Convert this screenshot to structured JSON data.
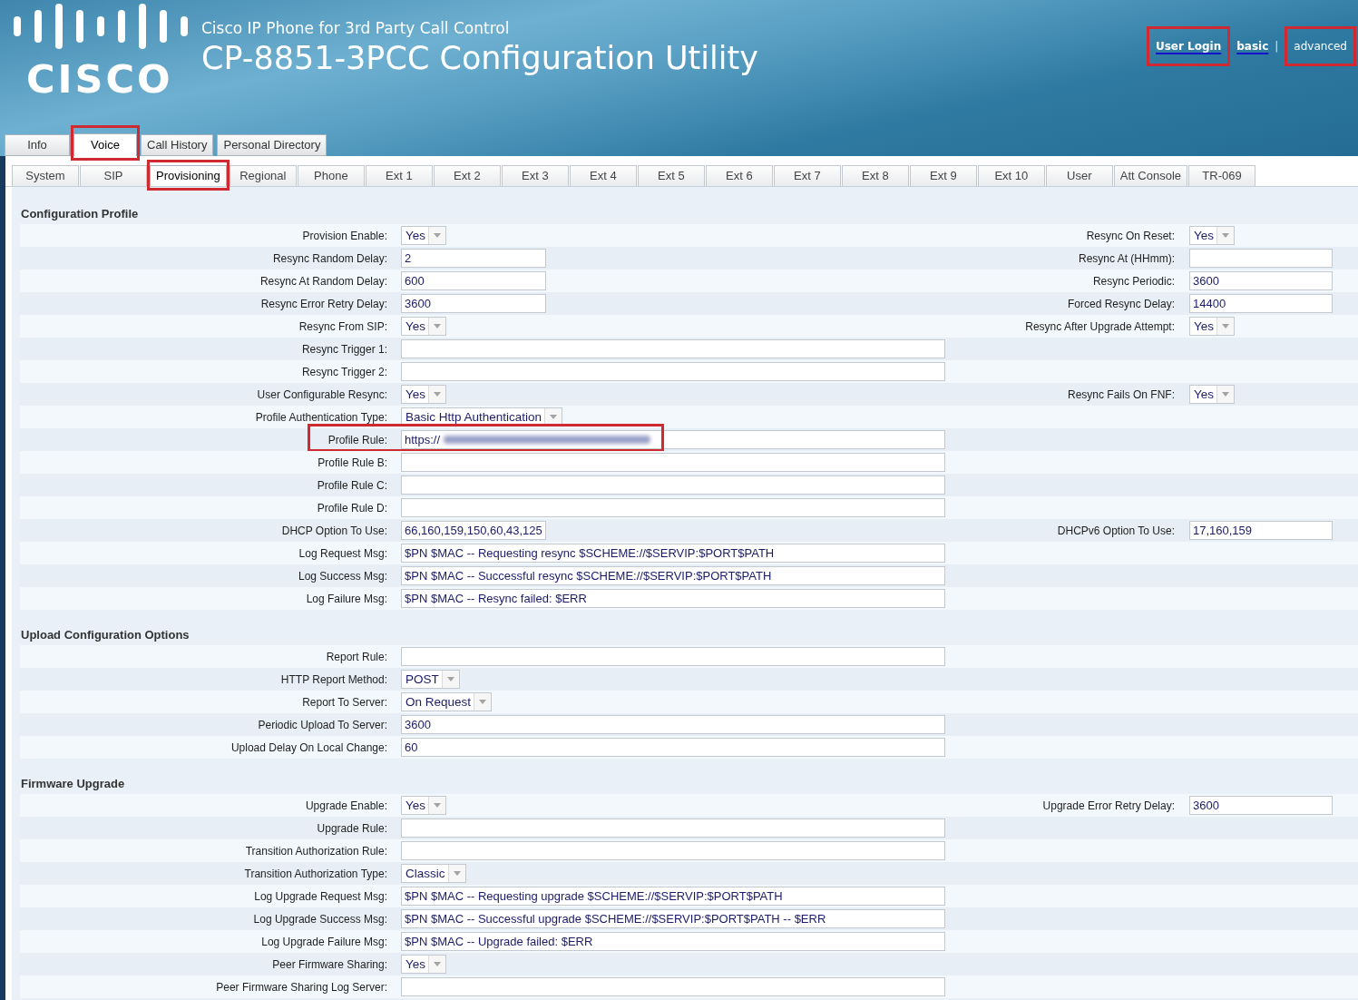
{
  "header": {
    "logo_text": "CISCO",
    "subtitle": "Cisco IP Phone for 3rd Party Call Control",
    "title": "CP-8851-3PCC Configuration Utility",
    "login_link": {
      "label": "User Login",
      "highlighted": true
    },
    "view_modes": [
      {
        "label": "basic",
        "selected": false,
        "highlighted": false
      },
      {
        "label": "advanced",
        "selected": true,
        "highlighted": true
      }
    ],
    "mode_separator": "|"
  },
  "main_tabs": [
    {
      "label": "Info",
      "selected": false,
      "highlighted": false
    },
    {
      "label": "Voice",
      "selected": true,
      "highlighted": true
    },
    {
      "label": "Call History",
      "selected": false,
      "highlighted": false
    },
    {
      "label": "Personal Directory",
      "selected": false,
      "highlighted": false
    }
  ],
  "sub_tabs": [
    {
      "label": "System",
      "selected": false,
      "highlighted": false
    },
    {
      "label": "SIP",
      "selected": false,
      "highlighted": false
    },
    {
      "label": "Provisioning",
      "selected": true,
      "highlighted": true
    },
    {
      "label": "Regional",
      "selected": false,
      "highlighted": false
    },
    {
      "label": "Phone",
      "selected": false,
      "highlighted": false
    },
    {
      "label": "Ext 1",
      "selected": false,
      "highlighted": false
    },
    {
      "label": "Ext 2",
      "selected": false,
      "highlighted": false
    },
    {
      "label": "Ext 3",
      "selected": false,
      "highlighted": false
    },
    {
      "label": "Ext 4",
      "selected": false,
      "highlighted": false
    },
    {
      "label": "Ext 5",
      "selected": false,
      "highlighted": false
    },
    {
      "label": "Ext 6",
      "selected": false,
      "highlighted": false
    },
    {
      "label": "Ext 7",
      "selected": false,
      "highlighted": false
    },
    {
      "label": "Ext 8",
      "selected": false,
      "highlighted": false
    },
    {
      "label": "Ext 9",
      "selected": false,
      "highlighted": false
    },
    {
      "label": "Ext 10",
      "selected": false,
      "highlighted": false
    },
    {
      "label": "User",
      "selected": false,
      "highlighted": false
    },
    {
      "label": "Att Console",
      "selected": false,
      "highlighted": false
    },
    {
      "label": "TR-069",
      "selected": false,
      "highlighted": false
    }
  ],
  "sections": [
    {
      "title": "Configuration Profile",
      "rows": [
        {
          "highlighted": false,
          "left": {
            "label": "Provision Enable:",
            "kind": "select",
            "value": "Yes"
          },
          "right": {
            "label": "Resync On Reset:",
            "kind": "select",
            "value": "Yes"
          }
        },
        {
          "highlighted": false,
          "left": {
            "label": "Resync Random Delay:",
            "kind": "short",
            "value": "2"
          },
          "right": {
            "label": "Resync At (HHmm):",
            "kind": "short"
          }
        },
        {
          "highlighted": false,
          "left": {
            "label": "Resync At Random Delay:",
            "kind": "short",
            "value": "600"
          },
          "right": {
            "label": "Resync Periodic:",
            "kind": "short",
            "value": "3600"
          }
        },
        {
          "highlighted": false,
          "left": {
            "label": "Resync Error Retry Delay:",
            "kind": "short",
            "value": "3600"
          },
          "right": {
            "label": "Forced Resync Delay:",
            "kind": "short",
            "value": "14400"
          }
        },
        {
          "highlighted": false,
          "left": {
            "label": "Resync From SIP:",
            "kind": "select",
            "value": "Yes"
          },
          "right": {
            "label": "Resync After Upgrade Attempt:",
            "kind": "select",
            "value": "Yes"
          }
        },
        {
          "highlighted": false,
          "left": {
            "label": "Resync Trigger 1:",
            "kind": "long"
          }
        },
        {
          "highlighted": false,
          "left": {
            "label": "Resync Trigger 2:",
            "kind": "long"
          }
        },
        {
          "highlighted": false,
          "left": {
            "label": "User Configurable Resync:",
            "kind": "select",
            "value": "Yes"
          },
          "right": {
            "label": "Resync Fails On FNF:",
            "kind": "select",
            "value": "Yes"
          }
        },
        {
          "highlighted": false,
          "left": {
            "label": "Profile Authentication Type:",
            "kind": "select",
            "value": "Basic Http Authentication"
          }
        },
        {
          "highlighted": true,
          "left": {
            "label": "Profile Rule:",
            "kind": "long",
            "value": "https://",
            "redacted": true
          }
        },
        {
          "highlighted": false,
          "left": {
            "label": "Profile Rule B:",
            "kind": "long"
          }
        },
        {
          "highlighted": false,
          "left": {
            "label": "Profile Rule C:",
            "kind": "long"
          }
        },
        {
          "highlighted": false,
          "left": {
            "label": "Profile Rule D:",
            "kind": "long"
          }
        },
        {
          "highlighted": false,
          "left": {
            "label": "DHCP Option To Use:",
            "kind": "short",
            "value": "66,160,159,150,60,43,125"
          },
          "right": {
            "label": "DHCPv6 Option To Use:",
            "kind": "short",
            "value": "17,160,159"
          }
        },
        {
          "highlighted": false,
          "left": {
            "label": "Log Request Msg:",
            "kind": "long",
            "value": "$PN $MAC -- Requesting resync $SCHEME://$SERVIP:$PORT$PATH"
          }
        },
        {
          "highlighted": false,
          "left": {
            "label": "Log Success Msg:",
            "kind": "long",
            "value": "$PN $MAC -- Successful resync $SCHEME://$SERVIP:$PORT$PATH"
          }
        },
        {
          "highlighted": false,
          "left": {
            "label": "Log Failure Msg:",
            "kind": "long",
            "value": "$PN $MAC -- Resync failed: $ERR"
          }
        }
      ]
    },
    {
      "title": "Upload Configuration Options",
      "rows": [
        {
          "highlighted": false,
          "left": {
            "label": "Report Rule:",
            "kind": "long"
          }
        },
        {
          "highlighted": false,
          "left": {
            "label": "HTTP Report Method:",
            "kind": "select",
            "value": "POST"
          }
        },
        {
          "highlighted": false,
          "left": {
            "label": "Report To Server:",
            "kind": "select",
            "value": "On Request"
          }
        },
        {
          "highlighted": false,
          "left": {
            "label": "Periodic Upload To Server:",
            "kind": "long",
            "value": "3600"
          }
        },
        {
          "highlighted": false,
          "left": {
            "label": "Upload Delay On Local Change:",
            "kind": "long",
            "value": "60"
          }
        }
      ]
    },
    {
      "title": "Firmware Upgrade",
      "rows": [
        {
          "highlighted": false,
          "left": {
            "label": "Upgrade Enable:",
            "kind": "select",
            "value": "Yes"
          },
          "right": {
            "label": "Upgrade Error Retry Delay:",
            "kind": "short",
            "value": "3600"
          }
        },
        {
          "highlighted": false,
          "left": {
            "label": "Upgrade Rule:",
            "kind": "long"
          }
        },
        {
          "highlighted": false,
          "left": {
            "label": "Transition Authorization Rule:",
            "kind": "long"
          }
        },
        {
          "highlighted": false,
          "left": {
            "label": "Transition Authorization Type:",
            "kind": "select",
            "value": "Classic"
          }
        },
        {
          "highlighted": false,
          "left": {
            "label": "Log Upgrade Request Msg:",
            "kind": "long",
            "value": "$PN $MAC -- Requesting upgrade $SCHEME://$SERVIP:$PORT$PATH"
          }
        },
        {
          "highlighted": false,
          "left": {
            "label": "Log Upgrade Success Msg:",
            "kind": "long",
            "value": "$PN $MAC -- Successful upgrade $SCHEME://$SERVIP:$PORT$PATH -- $ERR"
          }
        },
        {
          "highlighted": false,
          "left": {
            "label": "Log Upgrade Failure Msg:",
            "kind": "long",
            "value": "$PN $MAC -- Upgrade failed: $ERR"
          }
        },
        {
          "highlighted": false,
          "left": {
            "label": "Peer Firmware Sharing:",
            "kind": "select",
            "value": "Yes"
          }
        },
        {
          "highlighted": false,
          "left": {
            "label": "Peer Firmware Sharing Log Server:",
            "kind": "long"
          }
        }
      ]
    }
  ]
}
